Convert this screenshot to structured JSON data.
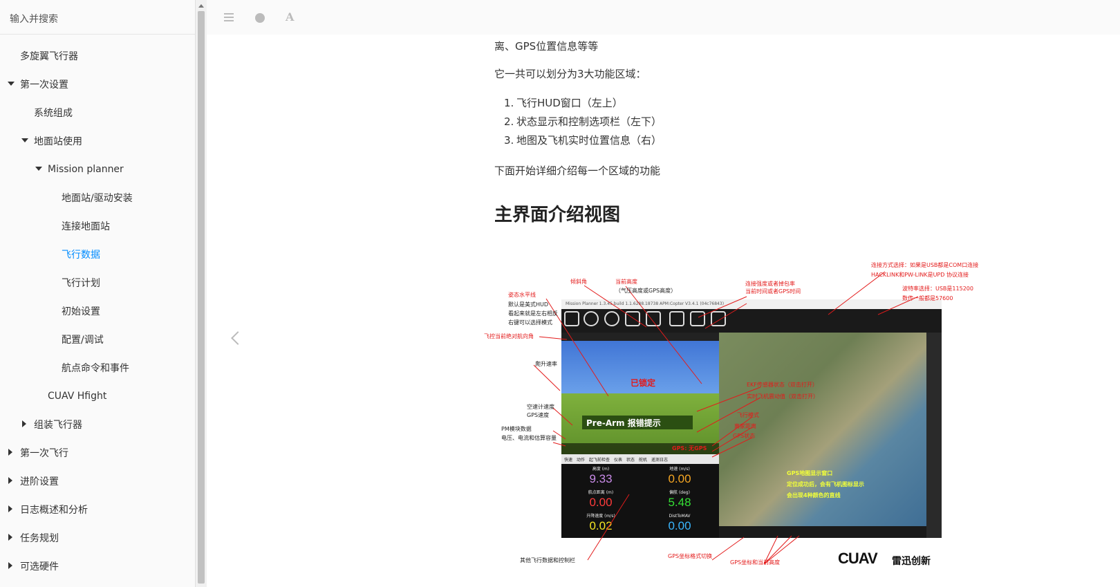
{
  "sidebar": {
    "search_placeholder": "输入并搜索",
    "items": [
      {
        "label": "多旋翼飞行器"
      },
      {
        "label": "第一次设置"
      },
      {
        "label": "系统组成"
      },
      {
        "label": "地面站使用"
      },
      {
        "label": "Mission planner"
      },
      {
        "label": "地面站/驱动安装"
      },
      {
        "label": "连接地面站"
      },
      {
        "label": "飞行数据"
      },
      {
        "label": "飞行计划"
      },
      {
        "label": "初始设置"
      },
      {
        "label": "配置/调试"
      },
      {
        "label": "航点命令和事件"
      },
      {
        "label": "CUAV Hfight"
      },
      {
        "label": "组装飞行器"
      },
      {
        "label": "第一次飞行"
      },
      {
        "label": "进阶设置"
      },
      {
        "label": "日志概述和分析"
      },
      {
        "label": "任务规划"
      },
      {
        "label": "可选硬件"
      }
    ]
  },
  "toolbar": {
    "font_glyph": "A"
  },
  "article": {
    "p1": "离、GPS位置信息等等",
    "p2": "它一共可以划分为3大功能区域：",
    "list": [
      {
        "num": "1.",
        "text": "飞行HUD窗口（左上）"
      },
      {
        "num": "2.",
        "text": "状态显示和控制选项栏（左下）"
      },
      {
        "num": "3.",
        "text": "地图及飞机实时位置信息（右）"
      }
    ],
    "p3": "下面开始详细介绍每一个区域的功能",
    "heading": "主界面介绍视图"
  },
  "figure": {
    "ann": {
      "attitude": "姿态水平线",
      "attitude_desc1": "默认是美式HUD",
      "attitude_desc2": "看起来就是左右相反",
      "attitude_desc3": "右键可以选择模式",
      "tilt": "倾斜角",
      "altitude": "当前高度",
      "altitude_sub": "（气压高度或GPS高度）",
      "link": "连接强度或者掉包率",
      "link2": "当前时间或者GPS时间",
      "conn1": "连接方式选择：如果是USB都是COM口连接",
      "conn2": "HACKLINK和PW-LINK是UPD 协议连接",
      "baud1": "波特率选择：USB是115200",
      "baud2": "数传一般都是57600",
      "heading_angle": "飞控当前绝对航向角",
      "climb": "爬升速率",
      "airspeed": "空速计速度",
      "gpsspeed": "GPS速度",
      "pm": "PM模块数据",
      "pm2": "电压、电流和估算容量",
      "ekf": "EKF传感器状态（双击打开）",
      "vibe": "实时飞机震动值（双击打开）",
      "mode": "飞行模式",
      "home": "离家距离",
      "gps": "GPS状态",
      "map1": "GPS地图显示窗口",
      "map2": "定位成功后，会有飞机图标显示",
      "map3": "会出现4种颜色的直线",
      "other": "其他飞行数据和控制栏",
      "gps_format": "GPS坐标格式切换",
      "gps_coord": "GPS坐标和当前高度"
    },
    "app_title": "Mission Planner 1.3.45 build 1.1.6288.18738 APM:Copter V3.4.1 (04c76843)",
    "hud_lock": "已锁定",
    "prearm": "Pre-Arm 报错提示",
    "gps_status": "GPS: 无GPS",
    "tabs": "快速　动作　起飞前检查　仪表　状态　舵机　遥测日志",
    "quick": [
      {
        "label": "高度 (m)",
        "value": "9.33",
        "color": "#c98be8"
      },
      {
        "label": "地速 (m/s)",
        "value": "0.00",
        "color": "#f5a623"
      },
      {
        "label": "航点距离 (m)",
        "value": "0.00",
        "color": "#ff3b3b"
      },
      {
        "label": "偏航 (deg)",
        "value": "5.48",
        "color": "#35e035"
      },
      {
        "label": "升降速度 (m/s)",
        "value": "0.02",
        "color": "#f5e623"
      },
      {
        "label": "DistToMAV",
        "value": "0.00",
        "color": "#3ab6ff"
      }
    ],
    "logo": "CUAV",
    "logo_sub": "雷迅创新"
  }
}
